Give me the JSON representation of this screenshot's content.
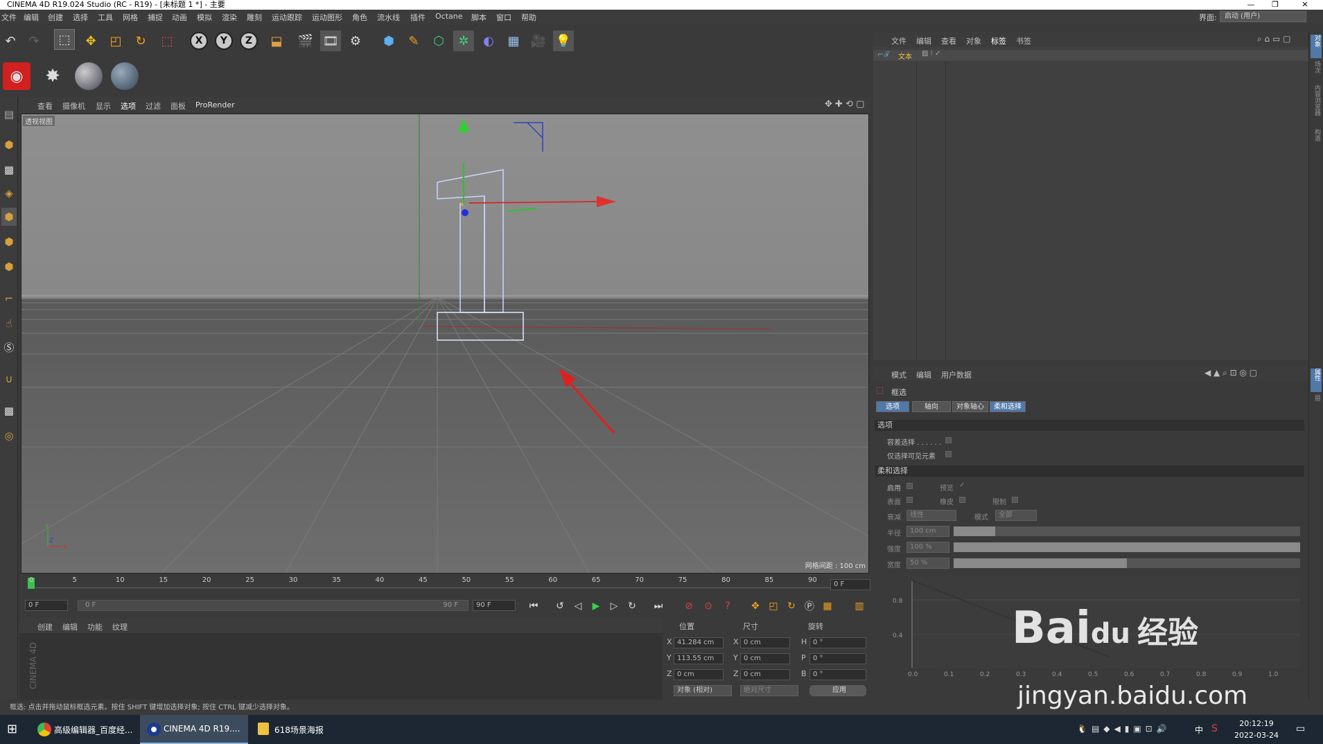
{
  "window": {
    "title": "CINEMA 4D R19.024 Studio (RC - R19) - [未标题 1 *] - 主要"
  },
  "menu": [
    "文件",
    "编辑",
    "创建",
    "选择",
    "工具",
    "网格",
    "捕捉",
    "动画",
    "模拟",
    "渲染",
    "雕刻",
    "运动跟踪",
    "运动图形",
    "角色",
    "流水线",
    "插件",
    "Octane",
    "脚本",
    "窗口",
    "帮助"
  ],
  "layout": {
    "label": "界面:",
    "value": "启动 (用户)"
  },
  "toolbar_icons": [
    "undo-icon",
    "redo-icon",
    "live-select-icon",
    "move-icon",
    "scale-icon",
    "rotate-icon",
    "recent-tools-icon",
    "x-axis-icon",
    "y-axis-icon",
    "z-axis-icon",
    "coordinate-system-icon",
    "render-view-icon",
    "render-to-picture-viewer-icon",
    "render-settings-icon",
    "cube-icon",
    "pen-icon",
    "subdivision-icon",
    "array-icon",
    "deformer-icon",
    "floor-icon",
    "camera-icon",
    "light-icon"
  ],
  "axis_labels": [
    "X",
    "Y",
    "Z"
  ],
  "viewport": {
    "menus": [
      "查看",
      "摄像机",
      "显示",
      "选项",
      "过滤",
      "面板",
      "ProRender"
    ],
    "label": "透视视图",
    "grid_spacing": "网格间距 : 100 cm"
  },
  "timeline": {
    "ticks": [
      "0",
      "5",
      "10",
      "15",
      "20",
      "25",
      "30",
      "35",
      "40",
      "45",
      "50",
      "55",
      "60",
      "65",
      "70",
      "75",
      "80",
      "85",
      "90"
    ],
    "current_frame": "0 F",
    "start": "0 F",
    "range_start": "0 F",
    "range_end": "90 F",
    "end": "90 F"
  },
  "material_manager": {
    "menus": [
      "创建",
      "编辑",
      "功能",
      "纹理"
    ],
    "brand": "CINEMA 4D"
  },
  "coordinates": {
    "headers": [
      "位置",
      "尺寸",
      "旋转"
    ],
    "rows": [
      {
        "pos_axis": "X",
        "pos": "41.284 cm",
        "size_axis": "X",
        "size": "0 cm",
        "rot_axis": "H",
        "rot": "0 °"
      },
      {
        "pos_axis": "Y",
        "pos": "113.55 cm",
        "size_axis": "Y",
        "size": "0 cm",
        "rot_axis": "P",
        "rot": "0 °"
      },
      {
        "pos_axis": "Z",
        "pos": "0 cm",
        "size_axis": "Z",
        "size": "0 cm",
        "rot_axis": "B",
        "rot": "0 °"
      }
    ],
    "mode": "对象 (相对)",
    "size_mode": "绝对尺寸",
    "apply": "应用"
  },
  "status": "框选: 点击并拖动鼠标框选元素。按住 SHIFT 键增加选择对象; 按住 CTRL 键减少选择对象。",
  "object_manager": {
    "menus": [
      "文件",
      "编辑",
      "查看",
      "对象",
      "标签",
      "书签"
    ],
    "object_name": "文本"
  },
  "attribute_manager": {
    "menus": [
      "模式",
      "编辑",
      "用户数据"
    ],
    "tool_name": "框选",
    "tabs": [
      "选项",
      "轴向",
      "对象轴心",
      "柔和选择"
    ],
    "section_options": "选项",
    "tolerant_select": "容差选择 . . . . . .",
    "only_visible": "仅选择可见元素",
    "section_soft": "柔和选择",
    "enable": "启用",
    "preview": "预览",
    "surface": "表面",
    "rubber": "橡皮",
    "restrict": "限制",
    "falloff": "衰减",
    "falloff_value": "线性",
    "mode": "模式",
    "mode_value": "全部",
    "radius": "半径",
    "radius_value": "100 cm",
    "strength": "强度",
    "strength_value": "100 %",
    "width": "宽度",
    "width_value": "50 %",
    "radius_fraction": 0.12,
    "strength_fraction": 1.0,
    "width_fraction": 0.5,
    "graph_y_ticks": [
      "0.8",
      "0.4"
    ],
    "graph_x_ticks": [
      "0.0",
      "0.1",
      "0.2",
      "0.3",
      "0.4",
      "0.5",
      "0.6",
      "0.7",
      "0.8",
      "0.9",
      "1.0"
    ]
  },
  "right_tabs": [
    "对象",
    "场次",
    "内容浏览器",
    "构造",
    "属性",
    "层"
  ],
  "taskbar": {
    "items": [
      {
        "label": "高级编辑器_百度经...",
        "icon": "chrome-icon"
      },
      {
        "label": "CINEMA 4D R19....",
        "icon": "cinema4d-icon"
      },
      {
        "label": "618场景海报",
        "icon": "folder-icon"
      }
    ],
    "ime": "中",
    "time": "20:12:19",
    "date": "2022-03-24"
  },
  "watermark": {
    "brand": "Bai",
    "paw": "du",
    "name": "经验",
    "url": "jingyan.baidu.com"
  }
}
